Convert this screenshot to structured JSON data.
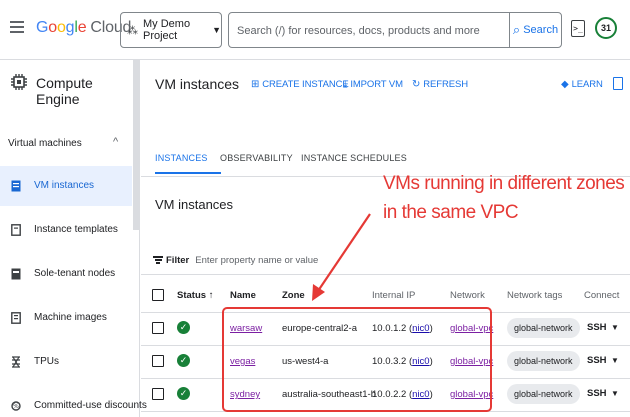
{
  "topbar": {
    "logo_parts": [
      "G",
      "o",
      "o",
      "g",
      "l",
      "e"
    ],
    "logo_suffix": "Cloud",
    "project_label": "My Demo Project",
    "search_placeholder": "Search (/) for resources, docs, products and more",
    "search_button": "Search",
    "notifications_badge": "31"
  },
  "sidebar": {
    "product_title": "Compute Engine",
    "section_title": "Virtual machines",
    "items": [
      {
        "label": "VM instances",
        "active": true
      },
      {
        "label": "Instance templates"
      },
      {
        "label": "Sole-tenant nodes"
      },
      {
        "label": "Machine images"
      },
      {
        "label": "TPUs"
      },
      {
        "label": "Committed-use discounts"
      }
    ]
  },
  "main": {
    "title": "VM instances",
    "actions": {
      "create": "CREATE INSTANCE",
      "import": "IMPORT VM",
      "refresh": "REFRESH",
      "learn": "LEARN"
    },
    "tabs": [
      "INSTANCES",
      "OBSERVABILITY",
      "INSTANCE SCHEDULES"
    ],
    "subtitle": "VM instances",
    "filter_label": "Filter",
    "filter_placeholder": "Enter property name or value",
    "columns": {
      "status": "Status",
      "name": "Name",
      "zone": "Zone",
      "internal_ip": "Internal IP",
      "network": "Network",
      "tags": "Network tags",
      "connect": "Connect"
    },
    "rows": [
      {
        "name": "warsaw",
        "zone": "europe-central2-a",
        "ip": "10.0.1.2",
        "nic": "nic0",
        "network": "global-vpc",
        "tag": "global-network",
        "connect": "SSH"
      },
      {
        "name": "vegas",
        "zone": "us-west4-a",
        "ip": "10.0.3.2",
        "nic": "nic0",
        "network": "global-vpc",
        "tag": "global-network",
        "connect": "SSH"
      },
      {
        "name": "sydney",
        "zone": "australia-southeast1-b",
        "ip": "10.0.2.2",
        "nic": "nic0",
        "network": "global-vpc",
        "tag": "global-network",
        "connect": "SSH"
      }
    ]
  },
  "annotation": {
    "line1": "VMs running in different zones",
    "line2": "in the same VPC",
    "color": "#e53935"
  }
}
